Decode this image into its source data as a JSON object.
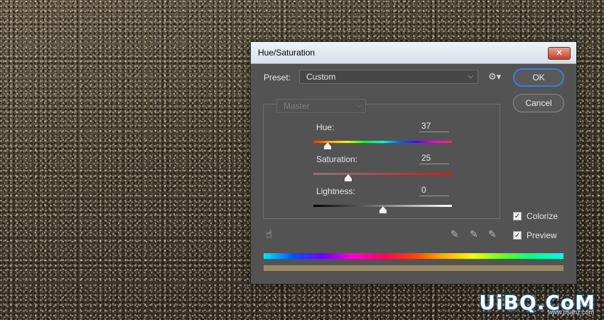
{
  "dialog": {
    "title": "Hue/Saturation",
    "close_glyph": "✕"
  },
  "preset": {
    "label": "Preset:",
    "value": "Custom"
  },
  "buttons": {
    "ok": "OK",
    "cancel": "Cancel"
  },
  "channel": {
    "value": "Master"
  },
  "sliders": {
    "hue": {
      "label": "Hue:",
      "value": "37",
      "position": 0.1
    },
    "saturation": {
      "label": "Saturation:",
      "value": "25",
      "position": 0.25
    },
    "lightness": {
      "label": "Lightness:",
      "value": "0",
      "position": 0.5
    }
  },
  "options": {
    "colorize": {
      "label": "Colorize",
      "checked": true
    },
    "preview": {
      "label": "Preview",
      "checked": true
    }
  },
  "icons": {
    "settings": "gear-icon",
    "on_image_adjust": "hand-icon",
    "eyedropper": "eyedropper-icon",
    "eyedropper_plus": "eyedropper-plus-icon",
    "eyedropper_minus": "eyedropper-minus-icon"
  },
  "colors": {
    "dialog_bg": "#535353",
    "result_bar": "#9c8a66",
    "ok_focus": "#3d7de0"
  },
  "watermark": {
    "brand": "UiBQ.CoM",
    "site": "www.psahz.com"
  }
}
